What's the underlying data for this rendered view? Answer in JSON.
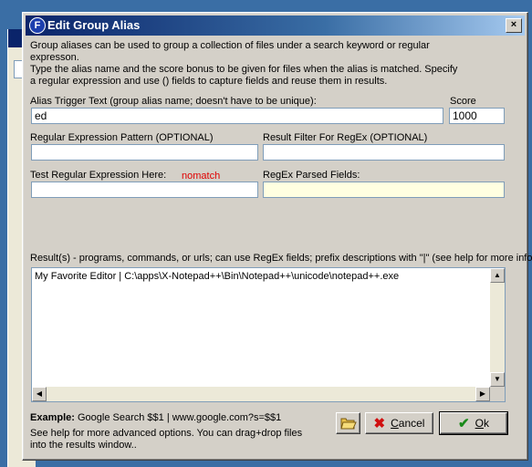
{
  "window": {
    "title": "Edit Group Alias",
    "app_icon_letter": "F",
    "close_glyph": "×"
  },
  "description": {
    "line1": "Group aliases can be used to group a collection of files under a search keyword or regular expresson.",
    "line2": "Type the alias name and the score bonus to be given for files when the alias is matched.  Specify a regular expression and use () fields to capture fields and reuse them in results."
  },
  "alias": {
    "label": "Alias Trigger Text (group alias name; doesn't have to be unique):",
    "value": "ed"
  },
  "score": {
    "label": "Score",
    "value": "1000"
  },
  "regex": {
    "label": "Regular Expression Pattern (OPTIONAL)",
    "value": ""
  },
  "result_filter": {
    "label": "Result Filter For RegEx (OPTIONAL)",
    "value": ""
  },
  "test_regex": {
    "label": "Test Regular Expression Here:",
    "status": "nomatch",
    "value": ""
  },
  "parsed_fields": {
    "label": "RegEx Parsed Fields:",
    "value": ""
  },
  "results": {
    "label": "Result(s) - programs, commands, or urls; can use RegEx fields; prefix descriptions with \"|\" (see help for more info)",
    "value": "My Favorite Editor | C:\\apps\\X-Notepad++\\Bin\\Notepad++\\unicode\\notepad++.exe"
  },
  "footer": {
    "example_label": "Example:",
    "example_text": "Google Search $$1 | www.google.com?s=$$1",
    "help_text": "See help for more advanced options.  You can drag+drop files into the results window.."
  },
  "buttons": {
    "cancel_first": "C",
    "cancel_rest": "ancel",
    "ok_first": "O",
    "ok_rest": "k"
  },
  "icons": {
    "folder": "folder-open-icon",
    "cancel": "red-x-icon",
    "ok": "green-check-icon"
  },
  "colors": {
    "titlebar": "#0a246a",
    "nomatch": "#e00000",
    "parsed_bg": "#ffffe1"
  }
}
